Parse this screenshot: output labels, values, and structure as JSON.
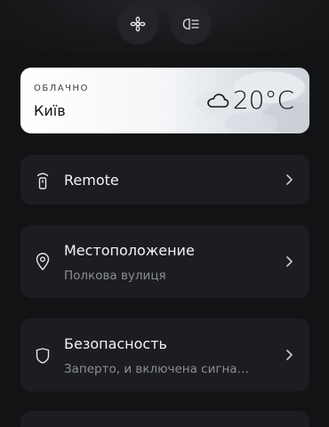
{
  "quick_actions": [
    {
      "icon": "fan-icon"
    },
    {
      "icon": "headlights-icon"
    }
  ],
  "weather": {
    "condition": "ОБЛАЧНО",
    "city": "Київ",
    "temperature": "20°C",
    "icon": "cloud-icon"
  },
  "rows": {
    "remote": {
      "title": "Remote",
      "icon": "remote-key-icon"
    },
    "location": {
      "title": "Местоположение",
      "subtitle": "Полкова вулиця",
      "icon": "location-pin-icon"
    },
    "security": {
      "title": "Безопасность",
      "subtitle": "Заперто, и включена сигна…",
      "icon": "shield-icon"
    }
  },
  "colors": {
    "background": "#121315",
    "card": "#1c1d20",
    "secondary_text": "#8b8e94"
  }
}
